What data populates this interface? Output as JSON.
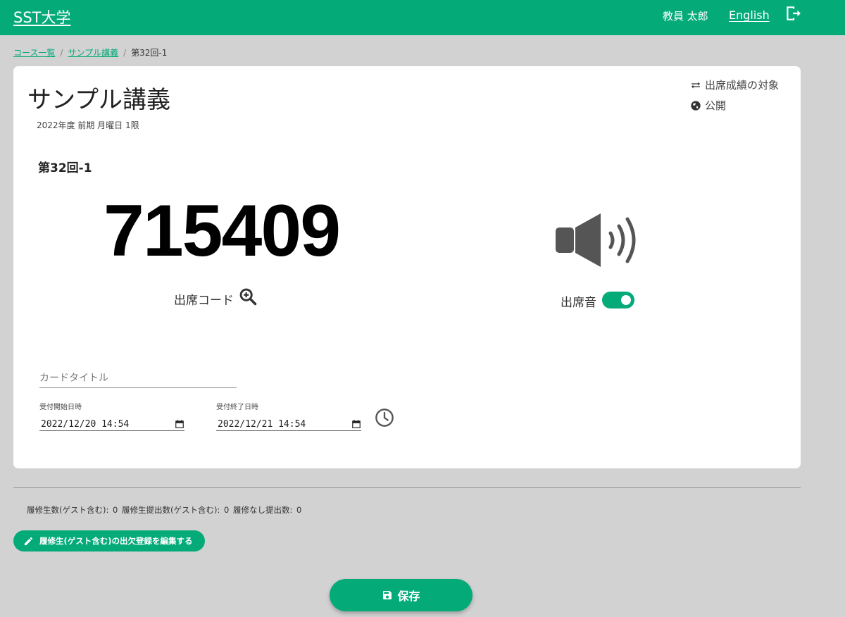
{
  "header": {
    "brand": "SST大学",
    "user_name": "教員 太郎",
    "language_link": "English"
  },
  "breadcrumb": {
    "items": [
      "コース一覧",
      "サンプル講義"
    ],
    "current": "第32回-1"
  },
  "course": {
    "title": "サンプル講義",
    "subtitle": "2022年度 前期 月曜日 1限",
    "target_label": "出席成績の対象",
    "public_label": "公開"
  },
  "session": {
    "title": "第32回-1",
    "attendance_code": "715409",
    "code_label": "出席コード",
    "sound_label": "出席音",
    "sound_enabled": true
  },
  "form": {
    "card_title_placeholder": "カードタイトル",
    "start_label": "受付開始日時",
    "start_value": "2022/12/20 14:54",
    "end_label": "受付終了日時",
    "end_value": "2022/12/21 14:54"
  },
  "summary": {
    "counts": "履修生数(ゲスト含む): 0  履修生提出数(ゲスト含む): 0  履修なし提出数: 0"
  },
  "actions": {
    "edit_attendance": "履修生(ゲスト含む)の出欠登録を編集する",
    "save": "保存"
  },
  "colors": {
    "accent": "#04ab79",
    "background": "#d2d2d2"
  }
}
